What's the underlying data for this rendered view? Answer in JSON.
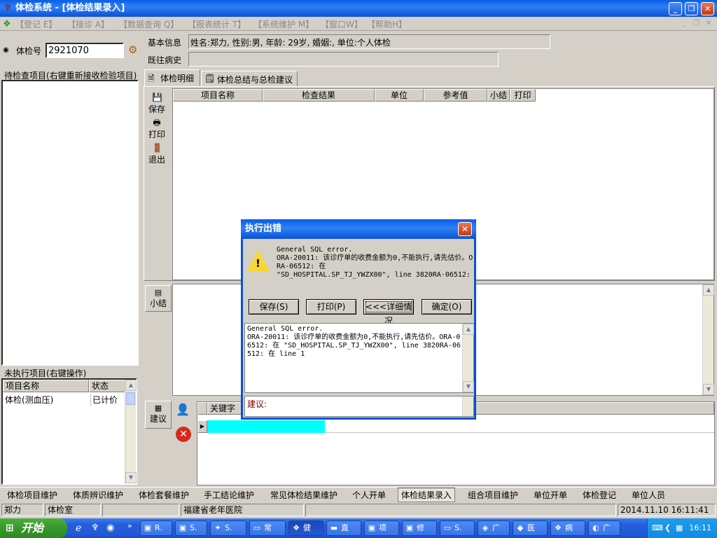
{
  "window": {
    "title": "体检系统 - [体检结果录入]"
  },
  "menu": [
    "【登记 E】",
    "【接诊 A】",
    "【数据查询 Q】",
    "【报表统计 T】",
    "【系统维护 M】",
    "【窗口W】",
    "【帮助H】"
  ],
  "left": {
    "exam_no_label": "体检号",
    "exam_no_value": "2921070",
    "pending_title": "待检查项目(右键重新接收检验项目)",
    "unexec_title": "未执行项目(右键操作)",
    "unexec_headers": [
      "项目名称",
      "状态"
    ],
    "unexec_rows": [
      {
        "name": "体检(测血压)",
        "status": "已计价"
      }
    ]
  },
  "info": {
    "basic_label": "基本信息",
    "basic_value": "姓名:郑力, 性别:男, 年龄: 29岁, 婚姻:, 单位:个人体检",
    "history_label": "既往病史",
    "history_value": ""
  },
  "tabs": [
    "体检明细",
    "体检总结与总检建议"
  ],
  "side_buttons": {
    "save": "保存",
    "print": "打印",
    "exit": "退出",
    "summary": "小结",
    "suggest": "建议"
  },
  "grid_headers": [
    "项目名称",
    "检查结果",
    "单位",
    "参考值",
    "小结",
    "打印"
  ],
  "keyword_header": "关键字",
  "dialog": {
    "title": "执行出错",
    "message": "General SQL error.\nORA-20011: 该诊疗单的收费金额为0,不能执行,请先估价。ORA-06512: 在\n\"SD_HOSPITAL.SP_TJ_YWZX00\", line 3820RA-06512:",
    "buttons": [
      "保存(S)",
      "打印(P)",
      "<<<详细情况",
      "确定(O)"
    ],
    "detail": "General SQL error.\nORA-20011: 该诊疗单的收费金额为0,不能执行,请先估价。ORA-06512: 在 \"SD_HOSPITAL.SP_TJ_YWZX00\", line 3820RA-06512: 在 line 1",
    "suggest_label": "建议:"
  },
  "bottom_tabs": [
    "体检项目维护",
    "体质辨识维护",
    "体检套餐维护",
    "手工结论维护",
    "常见体检结果维护",
    "个人开单",
    "体检结果录入",
    "组合项目维护",
    "单位开单",
    "体检登记",
    "单位人员"
  ],
  "status": {
    "user": "郑力",
    "dept": "体检室",
    "hospital": "福建省老年医院",
    "datetime": "2014.11.10 16:11:41"
  },
  "taskbar": {
    "start": "开始",
    "items": [
      "R.",
      "S.",
      "S.",
      "常",
      "健",
      "直",
      "项",
      "修",
      "S.",
      "广",
      "医",
      "病",
      "广"
    ],
    "clock": "16:11"
  },
  "colors": {
    "title_blue": "#0a5ee6",
    "cyan_row": "#00ffff",
    "error_red": "#d62a1c"
  }
}
